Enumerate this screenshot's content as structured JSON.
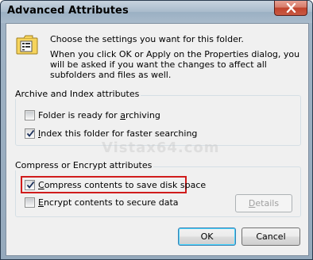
{
  "window": {
    "title": "Advanced Attributes"
  },
  "intro": {
    "line1": "Choose the settings you want for this folder.",
    "line2": "When you click OK or Apply on the Properties dialog, you will be asked if you want the changes to affect all subfolders and files as well."
  },
  "archive_group": {
    "label": "Archive and Index attributes",
    "archiving": {
      "pre": "Folder is ready for ",
      "key": "a",
      "post": "rchiving",
      "checked": false
    },
    "indexing": {
      "pre": "",
      "key": "I",
      "post": "ndex this folder for faster searching",
      "checked": true
    }
  },
  "compress_group": {
    "label": "Compress or Encrypt attributes",
    "compress": {
      "pre": "",
      "key": "C",
      "post": "ompress contents to save disk space",
      "checked": true
    },
    "encrypt": {
      "pre": "",
      "key": "E",
      "post": "ncrypt contents to secure data",
      "checked": false
    },
    "details": {
      "pre": "",
      "key": "D",
      "post": "etails",
      "enabled": false
    }
  },
  "buttons": {
    "ok": "OK",
    "cancel": "Cancel"
  },
  "watermark": "Vistax64.com",
  "colors": {
    "highlight_border": "#d01c1c",
    "close_button": "#c1432c"
  }
}
